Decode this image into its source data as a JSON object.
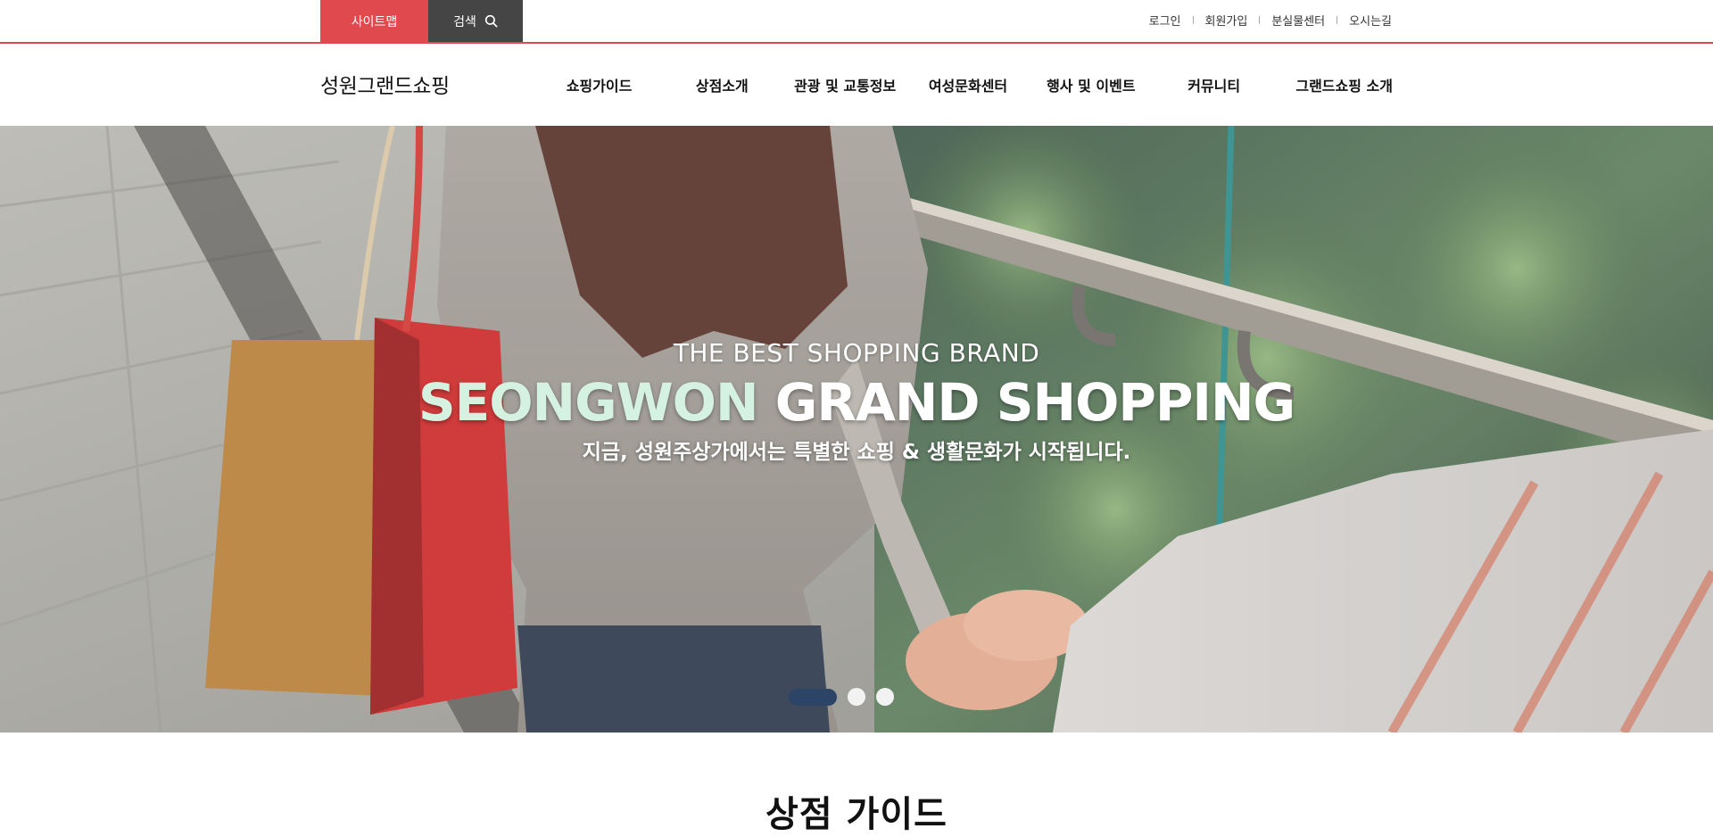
{
  "topbar": {
    "sitemap_label": "사이트맵",
    "search_label": "검색",
    "links": [
      "로그인",
      "회원가입",
      "분실물센터",
      "오시는길"
    ],
    "accent_color": "#e04a4e",
    "search_bg": "#454545"
  },
  "header": {
    "logo": "성원그랜드쇼핑",
    "nav": [
      "쇼핑가이드",
      "상점소개",
      "관광 및 교통정보",
      "여성문화센터",
      "행사 및 이벤트",
      "커뮤니티",
      "그랜드쇼핑 소개"
    ]
  },
  "hero": {
    "eyebrow": "THE BEST SHOPPING BRAND",
    "title_accent": "SEONGWON",
    "title_rest": " GRAND SHOPPING",
    "subtitle": "지금, 성원주상가에서는 특별한 쇼핑 & 생활문화가 시작됩니다.",
    "slides_total": 3,
    "active_slide": 1,
    "accent_color": "#d4f2df",
    "dot_active_color": "#2c4466"
  },
  "section": {
    "title": "상점 가이드"
  }
}
